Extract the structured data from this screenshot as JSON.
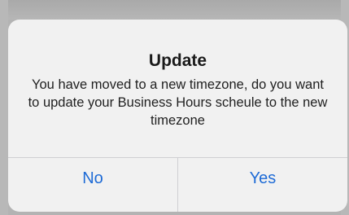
{
  "alert": {
    "title": "Update",
    "message": "You have moved to a new timezone, do you want to update your Business Hours scheule to the new timezone",
    "buttons": {
      "no": "No",
      "yes": "Yes"
    }
  },
  "colors": {
    "backdrop": "#b3b3b3",
    "dialog_background": "#f1f1f1",
    "button_text": "#1e6bd6",
    "divider": "#cfcfd2"
  }
}
